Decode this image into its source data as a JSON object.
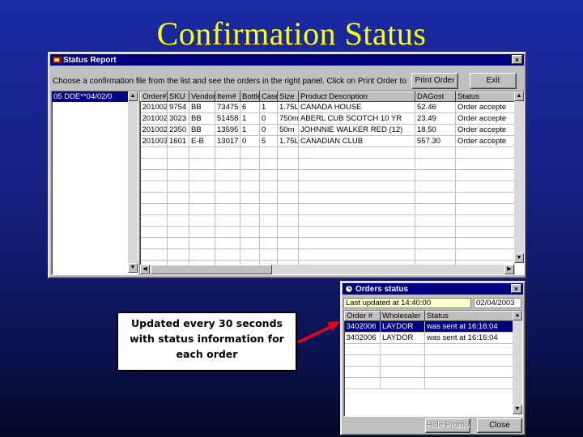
{
  "slide": {
    "title": "Confirmation Status"
  },
  "status_report": {
    "title": "Status Report",
    "close_glyph": "×",
    "instructions": "Choose a confirmation file from the list and see the orders in the right panel. Click on Print Order to print",
    "print_button": "Print Order",
    "exit_button": "Exit",
    "file_list": [
      "05 DDE**04/02/0"
    ],
    "columns": [
      "Order#",
      "SKU",
      "Vendor",
      "Item#",
      "Bottle",
      "Case",
      "Size",
      "Product Description",
      "DAGost",
      "Status"
    ],
    "rows": [
      [
        "201002",
        "9754",
        "BB",
        "73475",
        "6",
        "1",
        "1.75L",
        "CANADA HOUSE",
        "52.46",
        "Order accepte"
      ],
      [
        "201002",
        "3023",
        "BB",
        "51458",
        "1",
        "0",
        "750m",
        "ABERL CUB SCOTCH 10 YR",
        "23.49",
        "Order accepte"
      ],
      [
        "201002",
        "2350",
        "BB",
        "13595",
        "1",
        "0",
        "50m",
        "JOHNNIE WALKER RED (12)",
        "18.50",
        "Order accepte"
      ],
      [
        "201003",
        "1601",
        "E-B",
        "13017",
        "0",
        "5",
        "1.75L",
        "CANADIAN CLUB",
        "557.30",
        "Order accepte"
      ]
    ],
    "empty_rows": 12
  },
  "orders_status": {
    "title": "Orders status",
    "close_glyph": "×",
    "last_updated": "Last updated at 14:40:00",
    "date": "02/04/2003",
    "columns": [
      "Order #",
      "Wholesaler",
      "Status"
    ],
    "rows": [
      [
        "3402006",
        "LAYDOR",
        "was sent at 16:16:04"
      ],
      [
        "3402006",
        "LAYDOR",
        "was sent at 16:16:04"
      ]
    ],
    "empty_rows": 4,
    "hide_button": "Hide Promo",
    "close_button": "Close"
  },
  "callout": {
    "line1": "Updated every 30 seconds",
    "line2": "with status information for",
    "line3": "each order"
  },
  "colors": {
    "title": "#ffff00",
    "titlebar": "#000080",
    "arrow": "#e8001c",
    "highlight": "#ffffc8"
  }
}
